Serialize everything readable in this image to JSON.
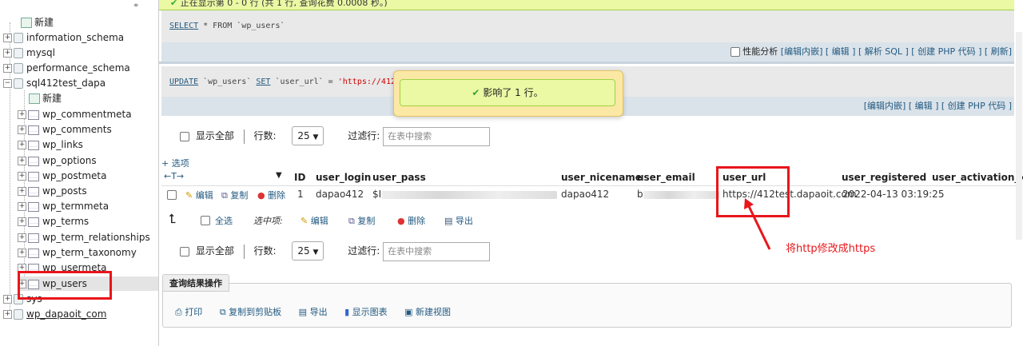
{
  "sidebar": {
    "link_icon": "chain-icon",
    "items": [
      {
        "label": "新建",
        "kind": "new"
      },
      {
        "label": "information_schema",
        "kind": "db"
      },
      {
        "label": "mysql",
        "kind": "db"
      },
      {
        "label": "performance_schema",
        "kind": "db"
      },
      {
        "label": "sql412test_dapa",
        "kind": "db-open"
      },
      {
        "label": "新建",
        "kind": "new-child"
      },
      {
        "label": "wp_commentmeta",
        "kind": "table"
      },
      {
        "label": "wp_comments",
        "kind": "table"
      },
      {
        "label": "wp_links",
        "kind": "table"
      },
      {
        "label": "wp_options",
        "kind": "table"
      },
      {
        "label": "wp_postmeta",
        "kind": "table"
      },
      {
        "label": "wp_posts",
        "kind": "table"
      },
      {
        "label": "wp_termmeta",
        "kind": "table"
      },
      {
        "label": "wp_terms",
        "kind": "table"
      },
      {
        "label": "wp_term_relationships",
        "kind": "table"
      },
      {
        "label": "wp_term_taxonomy",
        "kind": "table"
      },
      {
        "label": "wp_usermeta",
        "kind": "table"
      },
      {
        "label": "wp_users",
        "kind": "table-selected"
      },
      {
        "label": "sys",
        "kind": "db"
      },
      {
        "label": "wp_dapaoit_com",
        "kind": "db-link"
      }
    ]
  },
  "top_message": "正在显示第 0 - 0 行 (共 1 行, 查询花费 0.0008 秒。)",
  "query1": {
    "kw1": "SELECT",
    "rest": " * FROM `wp_users`"
  },
  "query1_links": {
    "profiling": "性能分析",
    "l1": "[编辑内嵌]",
    "l2": "[ 编辑 ]",
    "l3": "[ 解析 SQL ]",
    "l4": "[ 创建 PHP 代码 ]",
    "l5": "[ 刷新]"
  },
  "query2": {
    "kw1": "UPDATE",
    "t1": " `wp_users` ",
    "kw2": "SET",
    "t2": " `user_url` = ",
    "str": "'https://412t"
  },
  "query2_links": {
    "l1": "[编辑内嵌]",
    "l2": "[ 编辑 ]",
    "l3": "[ 创建 PHP 代码 ]"
  },
  "toast": {
    "message": "影响了 1 行。"
  },
  "controls": {
    "show_all": "显示全部",
    "rows_label": "行数:",
    "rows_value": "25",
    "filter_label": "过滤行:",
    "filter_placeholder": "在表中搜索"
  },
  "options_link": "+ 选项",
  "table": {
    "headers": [
      "ID",
      "user_login",
      "user_pass",
      "user_nicename",
      "user_email",
      "user_url",
      "user_registered",
      "user_activation_key"
    ],
    "row": {
      "edit": "编辑",
      "copy": "复制",
      "delete": "删除",
      "id": "1",
      "user_login": "dapao412",
      "user_pass": "$I",
      "user_nicename": "dapao412",
      "user_email": "b",
      "user_url": "https://412test.dapaoit.com",
      "user_registered": "2022-04-13 03:19:25"
    }
  },
  "bulk": {
    "check_all": "全选",
    "with_selected": "选中项:",
    "edit": "编辑",
    "copy": "复制",
    "delete": "删除",
    "export": "导出"
  },
  "annotation": {
    "text": "将http修改成https",
    "color": "#e8161b"
  },
  "query_ops": {
    "title": "查询结果操作",
    "print": "打印",
    "copy_clipboard": "复制到剪贴板",
    "export": "导出",
    "chart": "显示图表",
    "create_view": "新建视图"
  }
}
